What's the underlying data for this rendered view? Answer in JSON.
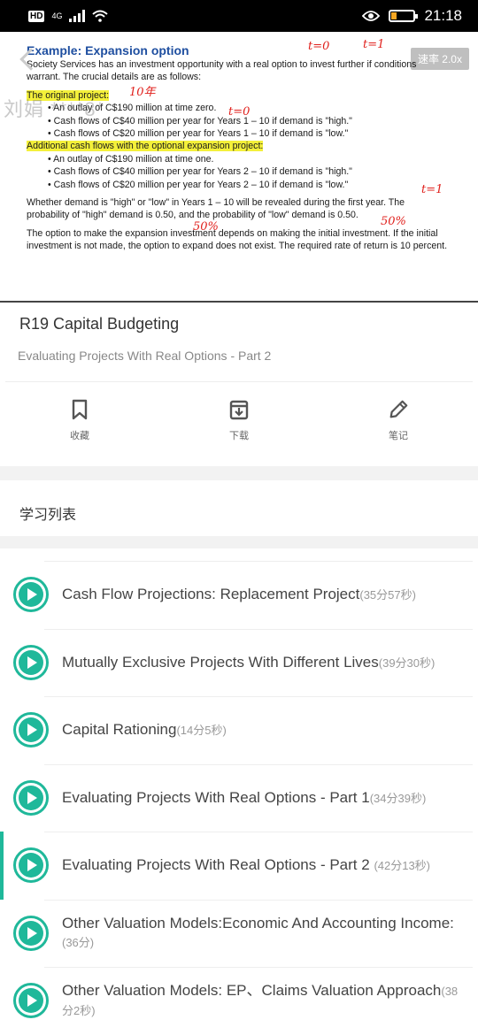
{
  "status_bar": {
    "hd": "HD",
    "network": "4G",
    "battery_level": 0.2,
    "time": "21:18"
  },
  "video": {
    "speed_label": "速率 2.0x",
    "watermark": "刘娟 ****8*",
    "slide": {
      "title": "Example: Expansion option",
      "intro": "Society Services has an investment opportunity with a real option to invest further if conditions warrant. The crucial details are as follows:",
      "original_heading": "The original project:",
      "original_items": [
        "An outlay of C$190 million at time zero.",
        "Cash flows of C$40 million per year for Years 1 – 10 if demand is \"high.\"",
        "Cash flows of C$20 million per year for Years 1 – 10 if demand is \"low.\""
      ],
      "additional_heading": "Additional cash flows with the optional expansion project:",
      "additional_items": [
        "An outlay of C$190 million at time one.",
        "Cash flows of C$40 million per year for Years 2 – 10 if demand is \"high.\"",
        "Cash flows of C$20 million per year for Years 2 – 10 if demand is \"low.\""
      ],
      "para1": "Whether demand is \"high\" or \"low\" in Years 1 – 10 will be revealed during the first year. The probability of \"high\" demand is 0.50, and the probability of \"low\" demand is 0.50.",
      "para2": "The option to make the expansion investment depends on making the initial investment. If the initial investment is not made, the option to expand does not exist. The required rate of return is 10 percent.",
      "annotations": [
        "t=0",
        "t=1",
        "10年",
        "t=0",
        "t=1",
        "50%",
        "50%"
      ]
    }
  },
  "course": {
    "title": "R19 Capital Budgeting",
    "subtitle": "Evaluating Projects With Real Options - Part 2"
  },
  "actions": [
    {
      "label": "收藏",
      "icon": "bookmark-icon"
    },
    {
      "label": "下载",
      "icon": "download-icon"
    },
    {
      "label": "笔记",
      "icon": "pencil-icon"
    }
  ],
  "section_title": "学习列表",
  "lessons": [
    {
      "title": "Cash Flow Projections: Replacement Project",
      "duration": "(35分57秒)",
      "active": false
    },
    {
      "title": "Mutually Exclusive Projects With Different Lives",
      "duration": "(39分30秒)",
      "active": false
    },
    {
      "title": "Capital Rationing",
      "duration": "(14分5秒)",
      "active": false
    },
    {
      "title": "Evaluating Projects With Real Options - Part 1",
      "duration": "(34分39秒)",
      "active": false
    },
    {
      "title": "Evaluating Projects With Real Options - Part 2 ",
      "duration": "(42分13秒)",
      "active": true
    },
    {
      "title": "Other Valuation Models:Economic And Accounting Income:",
      "duration": "(36分)",
      "active": false
    },
    {
      "title": "Other Valuation Models: EP、Claims Valuation Approach",
      "duration": "(38分2秒)",
      "active": false
    }
  ],
  "colors": {
    "accent": "#1fb89a",
    "slide_title": "#1f4fa0",
    "annotation": "#e0201c",
    "highlight": "#f4f03a"
  }
}
